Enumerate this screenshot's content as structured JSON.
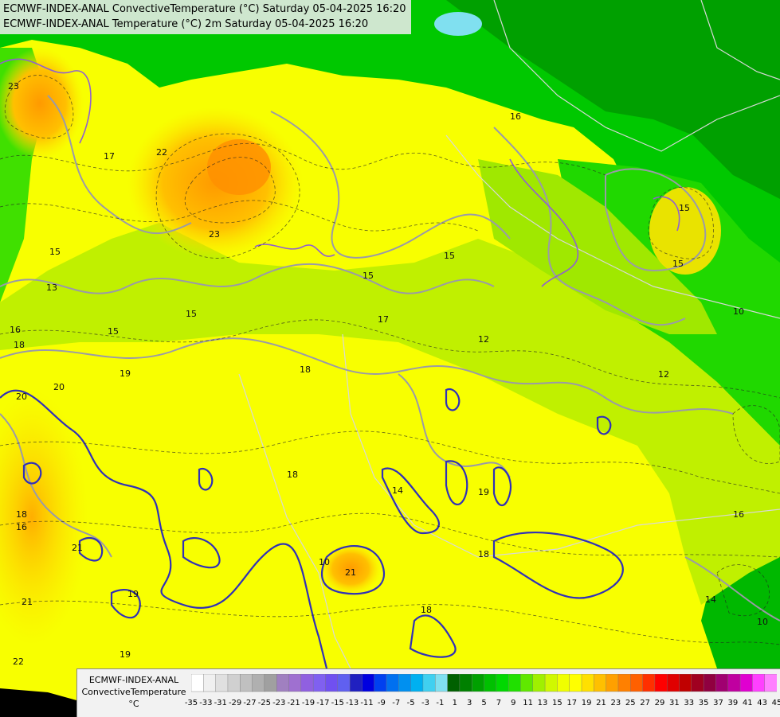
{
  "titles": {
    "line1": "ECMWF-INDEX-ANAL ConvectiveTemperature (°C) Saturday 05-04-2025 16:20",
    "line2": "ECMWF-INDEX-ANAL Temperature (°C) 2m Saturday 05-04-2025 16:20"
  },
  "legend": {
    "model": "ECMWF-INDEX-ANAL",
    "parameter": "ConvectiveTemperature",
    "unit": "°C",
    "ticks": [
      "-35",
      "-33",
      "-31",
      "-29",
      "-27",
      "-25",
      "-23",
      "-21",
      "-19",
      "-17",
      "-15",
      "-13",
      "-11",
      "-9",
      "-7",
      "-5",
      "-3",
      "-1",
      "1",
      "3",
      "5",
      "7",
      "9",
      "11",
      "13",
      "15",
      "17",
      "19",
      "21",
      "23",
      "25",
      "27",
      "29",
      "31",
      "33",
      "35",
      "37",
      "39",
      "41",
      "43",
      "45"
    ],
    "colors": [
      "#ffffff",
      "#f0f0f0",
      "#e0e0e0",
      "#d0d0d0",
      "#c0c0c0",
      "#b0b0b0",
      "#a0a0a0",
      "#a080c0",
      "#9f70d0",
      "#9060e0",
      "#8060f0",
      "#7050f0",
      "#6060f0",
      "#2020c0",
      "#0000e0",
      "#0040f0",
      "#0070f0",
      "#0090f0",
      "#00b0f0",
      "#40d0f0",
      "#80e0f0",
      "#006000",
      "#008000",
      "#00a000",
      "#00c000",
      "#00d800",
      "#20e000",
      "#60e800",
      "#a0f000",
      "#d0f800",
      "#f0ff00",
      "#ffff00",
      "#ffe000",
      "#ffc000",
      "#ffa000",
      "#ff8000",
      "#ff6000",
      "#ff3000",
      "#ff0000",
      "#e00000",
      "#c00000",
      "#a00020",
      "#900040",
      "#a00070",
      "#c000a0",
      "#e000d0",
      "#ff40ff",
      "#ff80ff"
    ]
  },
  "contour_labels": [
    "23",
    "22",
    "23",
    "15",
    "15",
    "15",
    "17",
    "18",
    "19",
    "20",
    "21",
    "19",
    "18",
    "19",
    "18",
    "21",
    "18",
    "13",
    "12",
    "10",
    "14",
    "16",
    "15",
    "16",
    "18",
    "20",
    "21",
    "22",
    "16",
    "15",
    "15",
    "10",
    "12",
    "16",
    "14",
    "10",
    "15",
    "17",
    "18",
    "19"
  ]
}
